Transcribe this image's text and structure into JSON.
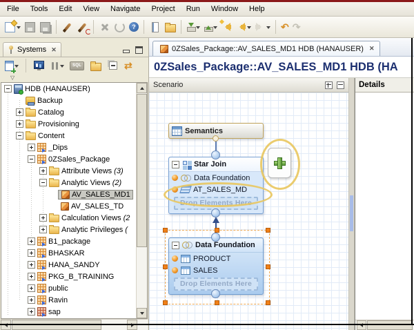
{
  "window": {
    "top_border_color": "#8b1a1a"
  },
  "menu_bar": {
    "items": [
      "File",
      "Tools",
      "Edit",
      "View",
      "Navigate",
      "Project",
      "Run",
      "Window",
      "Help"
    ]
  },
  "glyphs": {
    "close": "✕",
    "help": "?",
    "filter_arrow": "▽",
    "undo": "↶",
    "redo": "↷",
    "refresh": "⇄"
  },
  "main_toolbar": {
    "buttons": [
      "new-wizard",
      "save",
      "save-all",
      "activate",
      "validate",
      "delete",
      "revert",
      "help",
      "linked-editor",
      "open-folder",
      "import",
      "export",
      "last-edit-location",
      "back",
      "forward",
      "undo",
      "redo"
    ]
  },
  "systems_panel": {
    "tab": {
      "label": "Systems"
    },
    "toolbar": {
      "buttons": [
        "add-system",
        "administration-console",
        "configuration",
        "sql-console",
        "open-folder",
        "collapse-all",
        "refresh"
      ],
      "sql_label": "SQL"
    },
    "tree": {
      "items": [
        {
          "label": "HDB (HANAUSER)"
        },
        {
          "label": "Backup"
        },
        {
          "label": "Catalog"
        },
        {
          "label": "Provisioning"
        },
        {
          "label": "Content"
        },
        {
          "label": "_Dips"
        },
        {
          "label": "0ZSales_Package"
        },
        {
          "label": "Attribute Views",
          "suffix": "(3)"
        },
        {
          "label": "Analytic Views",
          "suffix": "(2)"
        },
        {
          "label": "AV_SALES_MD1",
          "selected": true
        },
        {
          "label": "AV_SALES_TD"
        },
        {
          "label": "Calculation Views",
          "suffix": "(2"
        },
        {
          "label": "Analytic Privileges",
          "suffix": "("
        },
        {
          "label": "B1_package"
        },
        {
          "label": "BHASKAR"
        },
        {
          "label": "HANA_SANDY"
        },
        {
          "label": "PKG_B_TRAINING"
        },
        {
          "label": "public"
        },
        {
          "label": "Ravin"
        },
        {
          "label": "sap"
        }
      ]
    }
  },
  "editor": {
    "tab": {
      "label": "0ZSales_Package::AV_SALES_MD1 HDB (HANAUSER)"
    },
    "title": "0ZSales_Package::AV_SALES_MD1 HDB (HA",
    "scenario": {
      "header": {
        "label": "Scenario"
      },
      "nodes": {
        "semantics": {
          "label": "Semantics"
        },
        "star_join": {
          "label": "Star Join",
          "rows": [
            {
              "label": "Data Foundation"
            },
            {
              "label": "AT_SALES_MD"
            }
          ],
          "drop_label": "Drop Elements Here"
        },
        "data_foundation": {
          "label": "Data Foundation",
          "rows": [
            {
              "label": "PRODUCT"
            },
            {
              "label": "SALES"
            }
          ],
          "drop_label": "Drop Elements Here"
        }
      }
    },
    "details_panel": {
      "header": "Details"
    }
  },
  "colors": {
    "highlight_ellipse": "#e9c65e",
    "selection_handle": "#f08018",
    "node_border": "#6f9ccf",
    "title_text": "#1c2f70",
    "grid_line": "#e2ebf7",
    "top_border": "#8b1a1a"
  }
}
